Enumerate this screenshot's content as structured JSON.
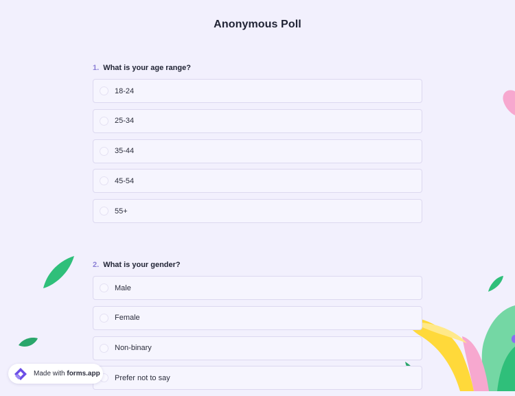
{
  "form": {
    "title": "Anonymous Poll"
  },
  "questions": [
    {
      "number": "1.",
      "text": "What is your age range?",
      "options": [
        "18-24",
        "25-34",
        "35-44",
        "45-54",
        "55+"
      ]
    },
    {
      "number": "2.",
      "text": "What is your gender?",
      "options": [
        "Male",
        "Female",
        "Non-binary",
        "Prefer not to say"
      ]
    }
  ],
  "badge": {
    "prefix": "Made with",
    "brand": "forms.app"
  },
  "colors": {
    "background": "#f2f0fd",
    "accent": "#8b7fd6",
    "leaf_green": "#2fbf7a",
    "petal_pink": "#f7a8cf",
    "petal_yellow": "#ffd93a",
    "logo_purple": "#6b4ee6"
  },
  "icons": {
    "badge_logo": "forms-app-logo-icon"
  }
}
